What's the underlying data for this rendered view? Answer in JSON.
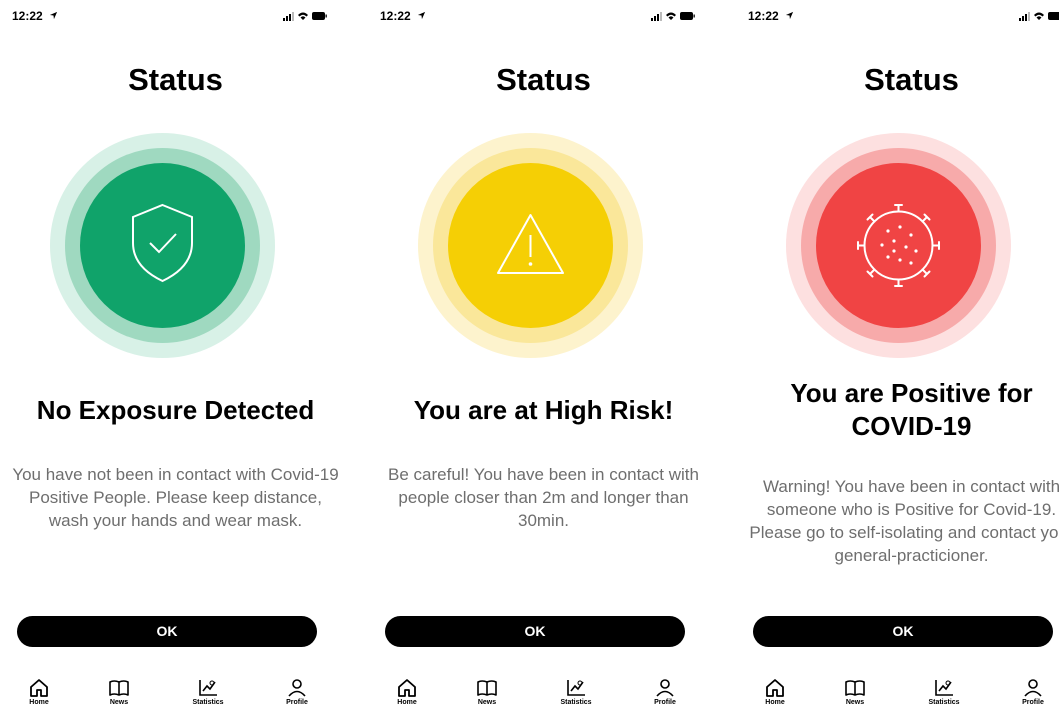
{
  "status_bar": {
    "time": "12:22"
  },
  "screens": [
    {
      "title": "Status",
      "headline": "No Exposure Detected",
      "message": "You have not been in contact with Covid-19 Positive People. Please keep distance, wash your hands and wear mask.",
      "button": "OK",
      "icon": "shield-check-icon",
      "colors": {
        "disc": "#10a36a",
        "ring_outer": "#d8f1e7",
        "ring_inner": "#9fd9c0"
      }
    },
    {
      "title": "Status",
      "headline": "You are at High Risk!",
      "message": "Be careful! You have been in contact with people closer than 2m and longer than 30min.",
      "button": "OK",
      "icon": "warning-triangle-icon",
      "colors": {
        "disc": "#f5cf05",
        "ring_outer": "#fdf3cd",
        "ring_inner": "#fae79a"
      }
    },
    {
      "title": "Status",
      "headline": "You are Positive for COVID-19",
      "message": "Warning! You have been in contact with someone who is Positive for Covid-19. Please go to self-isolating and contact your general-practicioner.",
      "button": "OK",
      "icon": "virus-icon",
      "colors": {
        "disc": "#f04444",
        "ring_outer": "#fde0e0",
        "ring_inner": "#f7aaaa"
      }
    }
  ],
  "tabbar": {
    "home": "Home",
    "news": "News",
    "statistics": "Statistics",
    "profile": "Profile"
  }
}
